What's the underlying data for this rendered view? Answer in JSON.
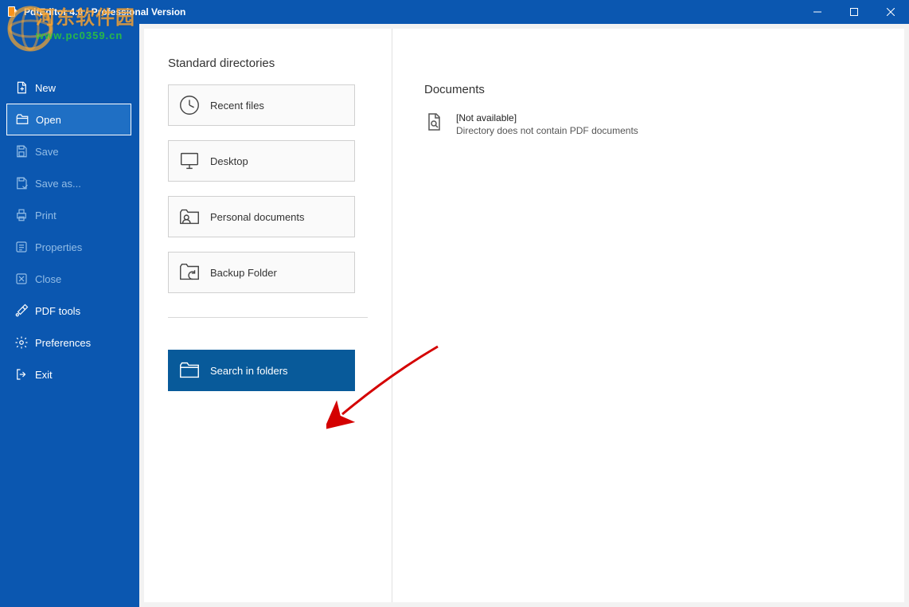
{
  "titlebar": {
    "title": "PdfEditor 4.0 - Professional Version"
  },
  "sidebar": {
    "items": [
      {
        "label": "New",
        "enabled": true
      },
      {
        "label": "Open",
        "enabled": true,
        "active": true
      },
      {
        "label": "Save",
        "enabled": false
      },
      {
        "label": "Save as...",
        "enabled": false
      },
      {
        "label": "Print",
        "enabled": false
      },
      {
        "label": "Properties",
        "enabled": false
      },
      {
        "label": "Close",
        "enabled": false
      },
      {
        "label": "PDF tools",
        "enabled": true
      },
      {
        "label": "Preferences",
        "enabled": true
      },
      {
        "label": "Exit",
        "enabled": true
      }
    ]
  },
  "main": {
    "section_title": "Standard directories",
    "tiles": [
      {
        "label": "Recent files"
      },
      {
        "label": "Desktop"
      },
      {
        "label": "Personal documents"
      },
      {
        "label": "Backup Folder"
      }
    ],
    "search_tile": {
      "label": "Search in folders"
    },
    "documents": {
      "title": "Documents",
      "not_available": "[Not available]",
      "message": "Directory does not contain PDF documents"
    }
  },
  "watermark": {
    "line1": "河东软件园",
    "line2": "www.pc0359.cn"
  }
}
